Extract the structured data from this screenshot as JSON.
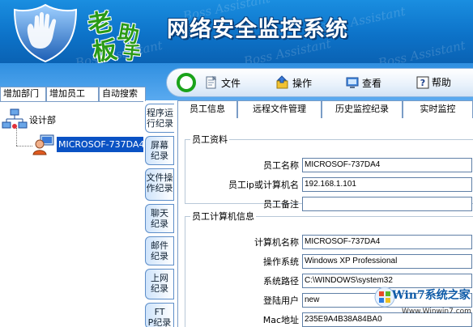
{
  "header": {
    "brand_chars": [
      "老",
      "板",
      "助",
      "手"
    ],
    "title": "网络安全监控系统",
    "watermark": "Boss Assistant"
  },
  "toolbar": {
    "items": [
      {
        "label": "文件",
        "icon": "file-icon"
      },
      {
        "label": "操作",
        "icon": "action-icon"
      },
      {
        "label": "查看",
        "icon": "view-icon"
      },
      {
        "label": "帮助",
        "icon": "help-icon"
      }
    ]
  },
  "left_tabs": [
    "增加部门",
    "增加员工",
    "自动搜索"
  ],
  "tree": {
    "root": "设计部",
    "child": "MICROSOF-737DA4"
  },
  "side_tabs": [
    "程序运行纪录",
    "屏幕纪录",
    "文件操作纪录",
    "聊天纪录",
    "邮件纪录",
    "上网纪录",
    "FTP纪录"
  ],
  "side_tabs_display": [
    "程序运\n行纪录",
    "屏幕\n纪录",
    "文件操\n作纪录",
    "聊天\n纪录",
    "邮件\n纪录",
    "上网\n纪录",
    "FT\nP纪录"
  ],
  "main_tabs": [
    "员工信息",
    "远程文件管理",
    "历史监控纪录",
    "实时监控"
  ],
  "employee_info": {
    "legend": "员工资料",
    "fields": [
      {
        "label": "员工名称",
        "value": "MICROSOF-737DA4"
      },
      {
        "label": "员工ip或计算机名",
        "value": "192.168.1.101"
      },
      {
        "label": "员工备注",
        "value": ""
      }
    ]
  },
  "computer_info": {
    "legend": "员工计算机信息",
    "fields": [
      {
        "label": "计算机名称",
        "value": "MICROSOF-737DA4"
      },
      {
        "label": "操作系统",
        "value": "Windows XP Professional"
      },
      {
        "label": "系统路径",
        "value": "C:\\WINDOWS\\system32"
      },
      {
        "label": "登陆用户",
        "value": "new"
      },
      {
        "label": "Mac地址",
        "value": "235E9A4B38A84BA0"
      }
    ]
  },
  "site_badge": {
    "title": "Win7系统之家",
    "url": "Www.Winwin7.com"
  },
  "colors": {
    "header_blue": "#0d73c9",
    "selection_blue": "#0a52c4",
    "brand_green": "#2a9a16"
  }
}
